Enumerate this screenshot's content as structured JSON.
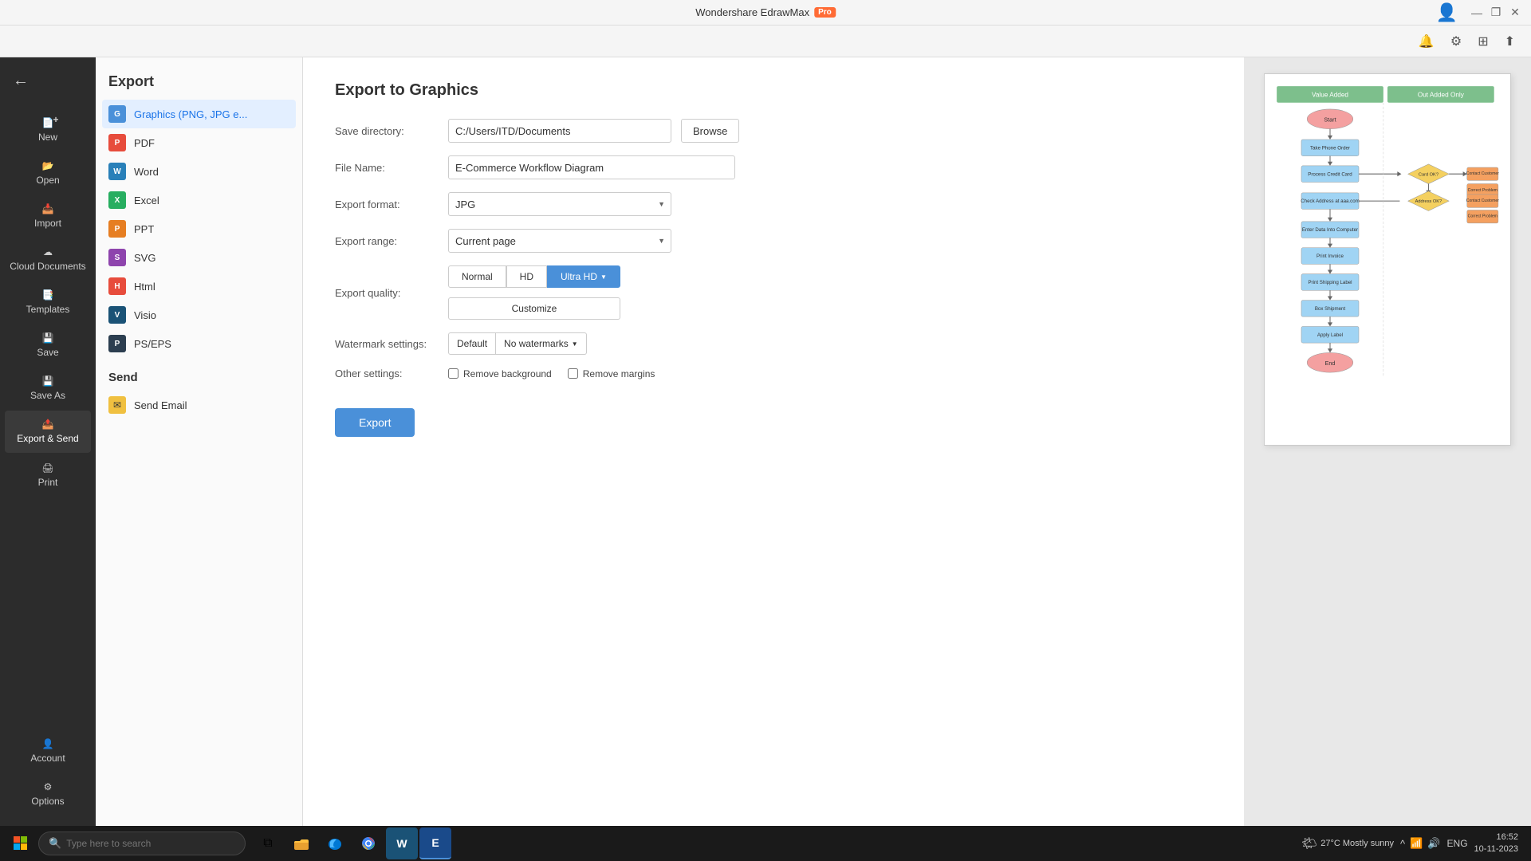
{
  "titlebar": {
    "app_name": "Wondershare EdrawMax",
    "pro_label": "Pro",
    "minimize": "—",
    "restore": "❐",
    "close": "✕"
  },
  "toolbar": {
    "notification_icon": "🔔",
    "settings_icon": "⚙",
    "grid_icon": "⊞",
    "share_icon": "↑"
  },
  "sidebar": {
    "back_label": "←",
    "items": [
      {
        "id": "new",
        "label": "New",
        "icon": "📄"
      },
      {
        "id": "open",
        "label": "Open",
        "icon": "📂"
      },
      {
        "id": "import",
        "label": "Import",
        "icon": "📥"
      },
      {
        "id": "cloud",
        "label": "Cloud Documents",
        "icon": "☁"
      },
      {
        "id": "templates",
        "label": "Templates",
        "icon": "📑"
      },
      {
        "id": "save",
        "label": "Save",
        "icon": "💾"
      },
      {
        "id": "save-as",
        "label": "Save As",
        "icon": "💾"
      },
      {
        "id": "export-send",
        "label": "Export & Send",
        "icon": "📤"
      },
      {
        "id": "print",
        "label": "Print",
        "icon": "🖨"
      }
    ],
    "bottom_items": [
      {
        "id": "account",
        "label": "Account",
        "icon": "👤"
      },
      {
        "id": "options",
        "label": "Options",
        "icon": "⚙"
      }
    ]
  },
  "export_panel": {
    "title": "Export",
    "formats": [
      {
        "id": "graphics",
        "label": "Graphics (PNG, JPG e...",
        "color": "icon-png",
        "char": "G",
        "active": true
      },
      {
        "id": "pdf",
        "label": "PDF",
        "color": "icon-pdf",
        "char": "P"
      },
      {
        "id": "word",
        "label": "Word",
        "color": "icon-word",
        "char": "W"
      },
      {
        "id": "excel",
        "label": "Excel",
        "color": "icon-excel",
        "char": "X"
      },
      {
        "id": "ppt",
        "label": "PPT",
        "color": "icon-ppt",
        "char": "P"
      },
      {
        "id": "svg",
        "label": "SVG",
        "color": "icon-svg",
        "char": "S"
      },
      {
        "id": "html",
        "label": "Html",
        "color": "icon-html",
        "char": "H"
      },
      {
        "id": "visio",
        "label": "Visio",
        "color": "icon-visio",
        "char": "V"
      },
      {
        "id": "pseps",
        "label": "PS/EPS",
        "color": "icon-pseps",
        "char": "P"
      }
    ],
    "send_section": {
      "title": "Send",
      "items": [
        {
          "id": "send-email",
          "label": "Send Email",
          "icon": "✉"
        }
      ]
    }
  },
  "form": {
    "title": "Export to Graphics",
    "save_directory_label": "Save directory:",
    "save_directory_value": "C:/Users/ITD/Documents",
    "file_name_label": "File Name:",
    "file_name_value": "E-Commerce Workflow Diagram",
    "export_format_label": "Export format:",
    "export_format_value": "JPG",
    "export_range_label": "Export range:",
    "export_range_value": "Current page",
    "export_quality_label": "Export quality:",
    "quality_normal": "Normal",
    "quality_hd": "HD",
    "quality_ultra_hd": "Ultra HD",
    "customize_label": "Customize",
    "watermark_label": "Watermark settings:",
    "watermark_default": "Default",
    "watermark_none": "No watermarks",
    "other_settings_label": "Other settings:",
    "remove_bg_label": "Remove background",
    "remove_margins_label": "Remove margins",
    "browse_label": "Browse",
    "export_button_label": "Export"
  },
  "taskbar": {
    "search_placeholder": "Type here to search",
    "weather": "27°C  Mostly sunny",
    "time": "16:52",
    "date": "10-11-2023",
    "language": "ENG",
    "apps": [
      {
        "id": "start",
        "icon": "⊞"
      },
      {
        "id": "search",
        "icon": "🔍"
      },
      {
        "id": "taskview",
        "icon": "⧉"
      },
      {
        "id": "explorer",
        "icon": "📁"
      },
      {
        "id": "edge",
        "icon": "🌐"
      },
      {
        "id": "chrome",
        "icon": "⊙"
      },
      {
        "id": "word",
        "icon": "W"
      },
      {
        "id": "edraw",
        "icon": "E"
      }
    ]
  }
}
